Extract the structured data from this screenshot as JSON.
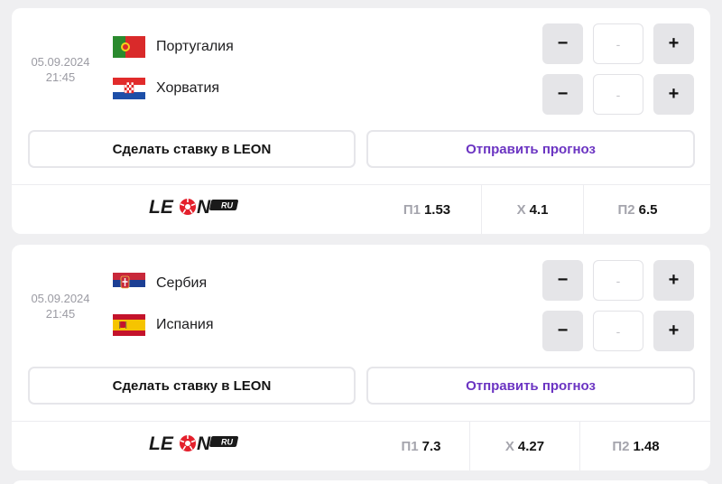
{
  "matches": [
    {
      "date": "05.09.2024",
      "time": "21:45",
      "team1": {
        "name": "Португалия",
        "flag": "portugal-flag"
      },
      "team2": {
        "name": "Хорватия",
        "flag": "croatia-flag"
      },
      "score_placeholder": "-",
      "bet_label": "Сделать ставку в LEON",
      "forecast_label": "Отправить прогноз",
      "odds": [
        {
          "label": "П1",
          "value": "1.53"
        },
        {
          "label": "Х",
          "value": "4.1"
        },
        {
          "label": "П2",
          "value": "6.5"
        }
      ]
    },
    {
      "date": "05.09.2024",
      "time": "21:45",
      "team1": {
        "name": "Сербия",
        "flag": "serbia-flag"
      },
      "team2": {
        "name": "Испания",
        "flag": "spain-flag"
      },
      "score_placeholder": "-",
      "bet_label": "Сделать ставку в LEON",
      "forecast_label": "Отправить прогноз",
      "odds": [
        {
          "label": "П1",
          "value": "7.3"
        },
        {
          "label": "Х",
          "value": "4.27"
        },
        {
          "label": "П2",
          "value": "1.48"
        }
      ]
    }
  ],
  "stepper": {
    "minus": "−",
    "plus": "+"
  },
  "logo": {
    "text_le": "LE",
    "text_n": "N",
    "badge": "RU"
  },
  "colors": {
    "accent": "#6b34c2",
    "brand": "#1a1a1a",
    "ball": "#e4202c"
  }
}
